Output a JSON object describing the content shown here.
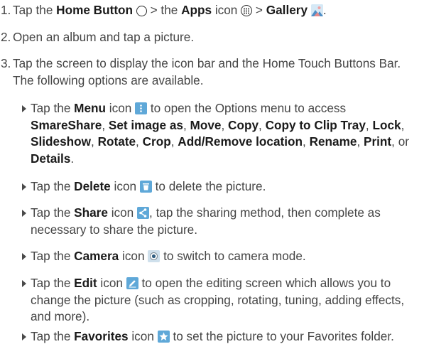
{
  "steps": [
    {
      "number": "1.",
      "parts": [
        "Tap the ",
        "Home Button",
        " > the ",
        "Apps",
        " icon ",
        " > ",
        "Gallery",
        "."
      ]
    },
    {
      "number": "2.",
      "text": "Open an album and tap a picture."
    },
    {
      "number": "3.",
      "line1": "Tap the screen to display the icon bar and the Home Touch Buttons Bar.",
      "line2": "The following options are available."
    }
  ],
  "bullets": [
    {
      "pre": "Tap the ",
      "name": "Menu",
      "mid": " icon ",
      "post": " to open the Options menu to access",
      "options": [
        "SmareShare",
        "Set image as",
        "Move",
        "Copy",
        "Copy to Clip Tray",
        "Lock",
        "Slideshow",
        "Rotate",
        "Crop",
        "Add/Remove location",
        "Rename",
        "Print",
        "Details"
      ],
      "or_word": "or"
    },
    {
      "pre": "Tap the ",
      "name": "Delete",
      "mid": " icon ",
      "post": " to delete the picture."
    },
    {
      "pre": "Tap the ",
      "name": "Share",
      "mid": " icon ",
      "post": ", tap the sharing method, then complete as",
      "line2": "necessary to share the picture."
    },
    {
      "pre": "Tap the ",
      "name": "Camera",
      "mid": " icon ",
      "post": " to switch to camera mode."
    },
    {
      "pre": "Tap the ",
      "name": "Edit",
      "mid": " icon ",
      "post": " to open the editing screen which allows you to",
      "line2": "change the picture (such as cropping, rotating, tuning, adding effects,",
      "line3": "and more)."
    },
    {
      "pre": "Tap the ",
      "name": "Favorites",
      "mid": " icon ",
      "post": " to set the picture to your Favorites folder."
    }
  ],
  "icons": {
    "home": "home-button-circle-icon",
    "apps": "apps-grid-icon",
    "gallery": "gallery-icon",
    "menu": "menu-icon",
    "delete": "trash-icon",
    "share": "share-icon",
    "camera": "camera-icon",
    "edit": "pencil-icon",
    "favorites": "star-icon"
  },
  "colors": {
    "text": "#454545",
    "emphasis": "#1a1a1a",
    "icon_blue": "#5fa8d8",
    "icon_yellow": "#f0c419"
  }
}
